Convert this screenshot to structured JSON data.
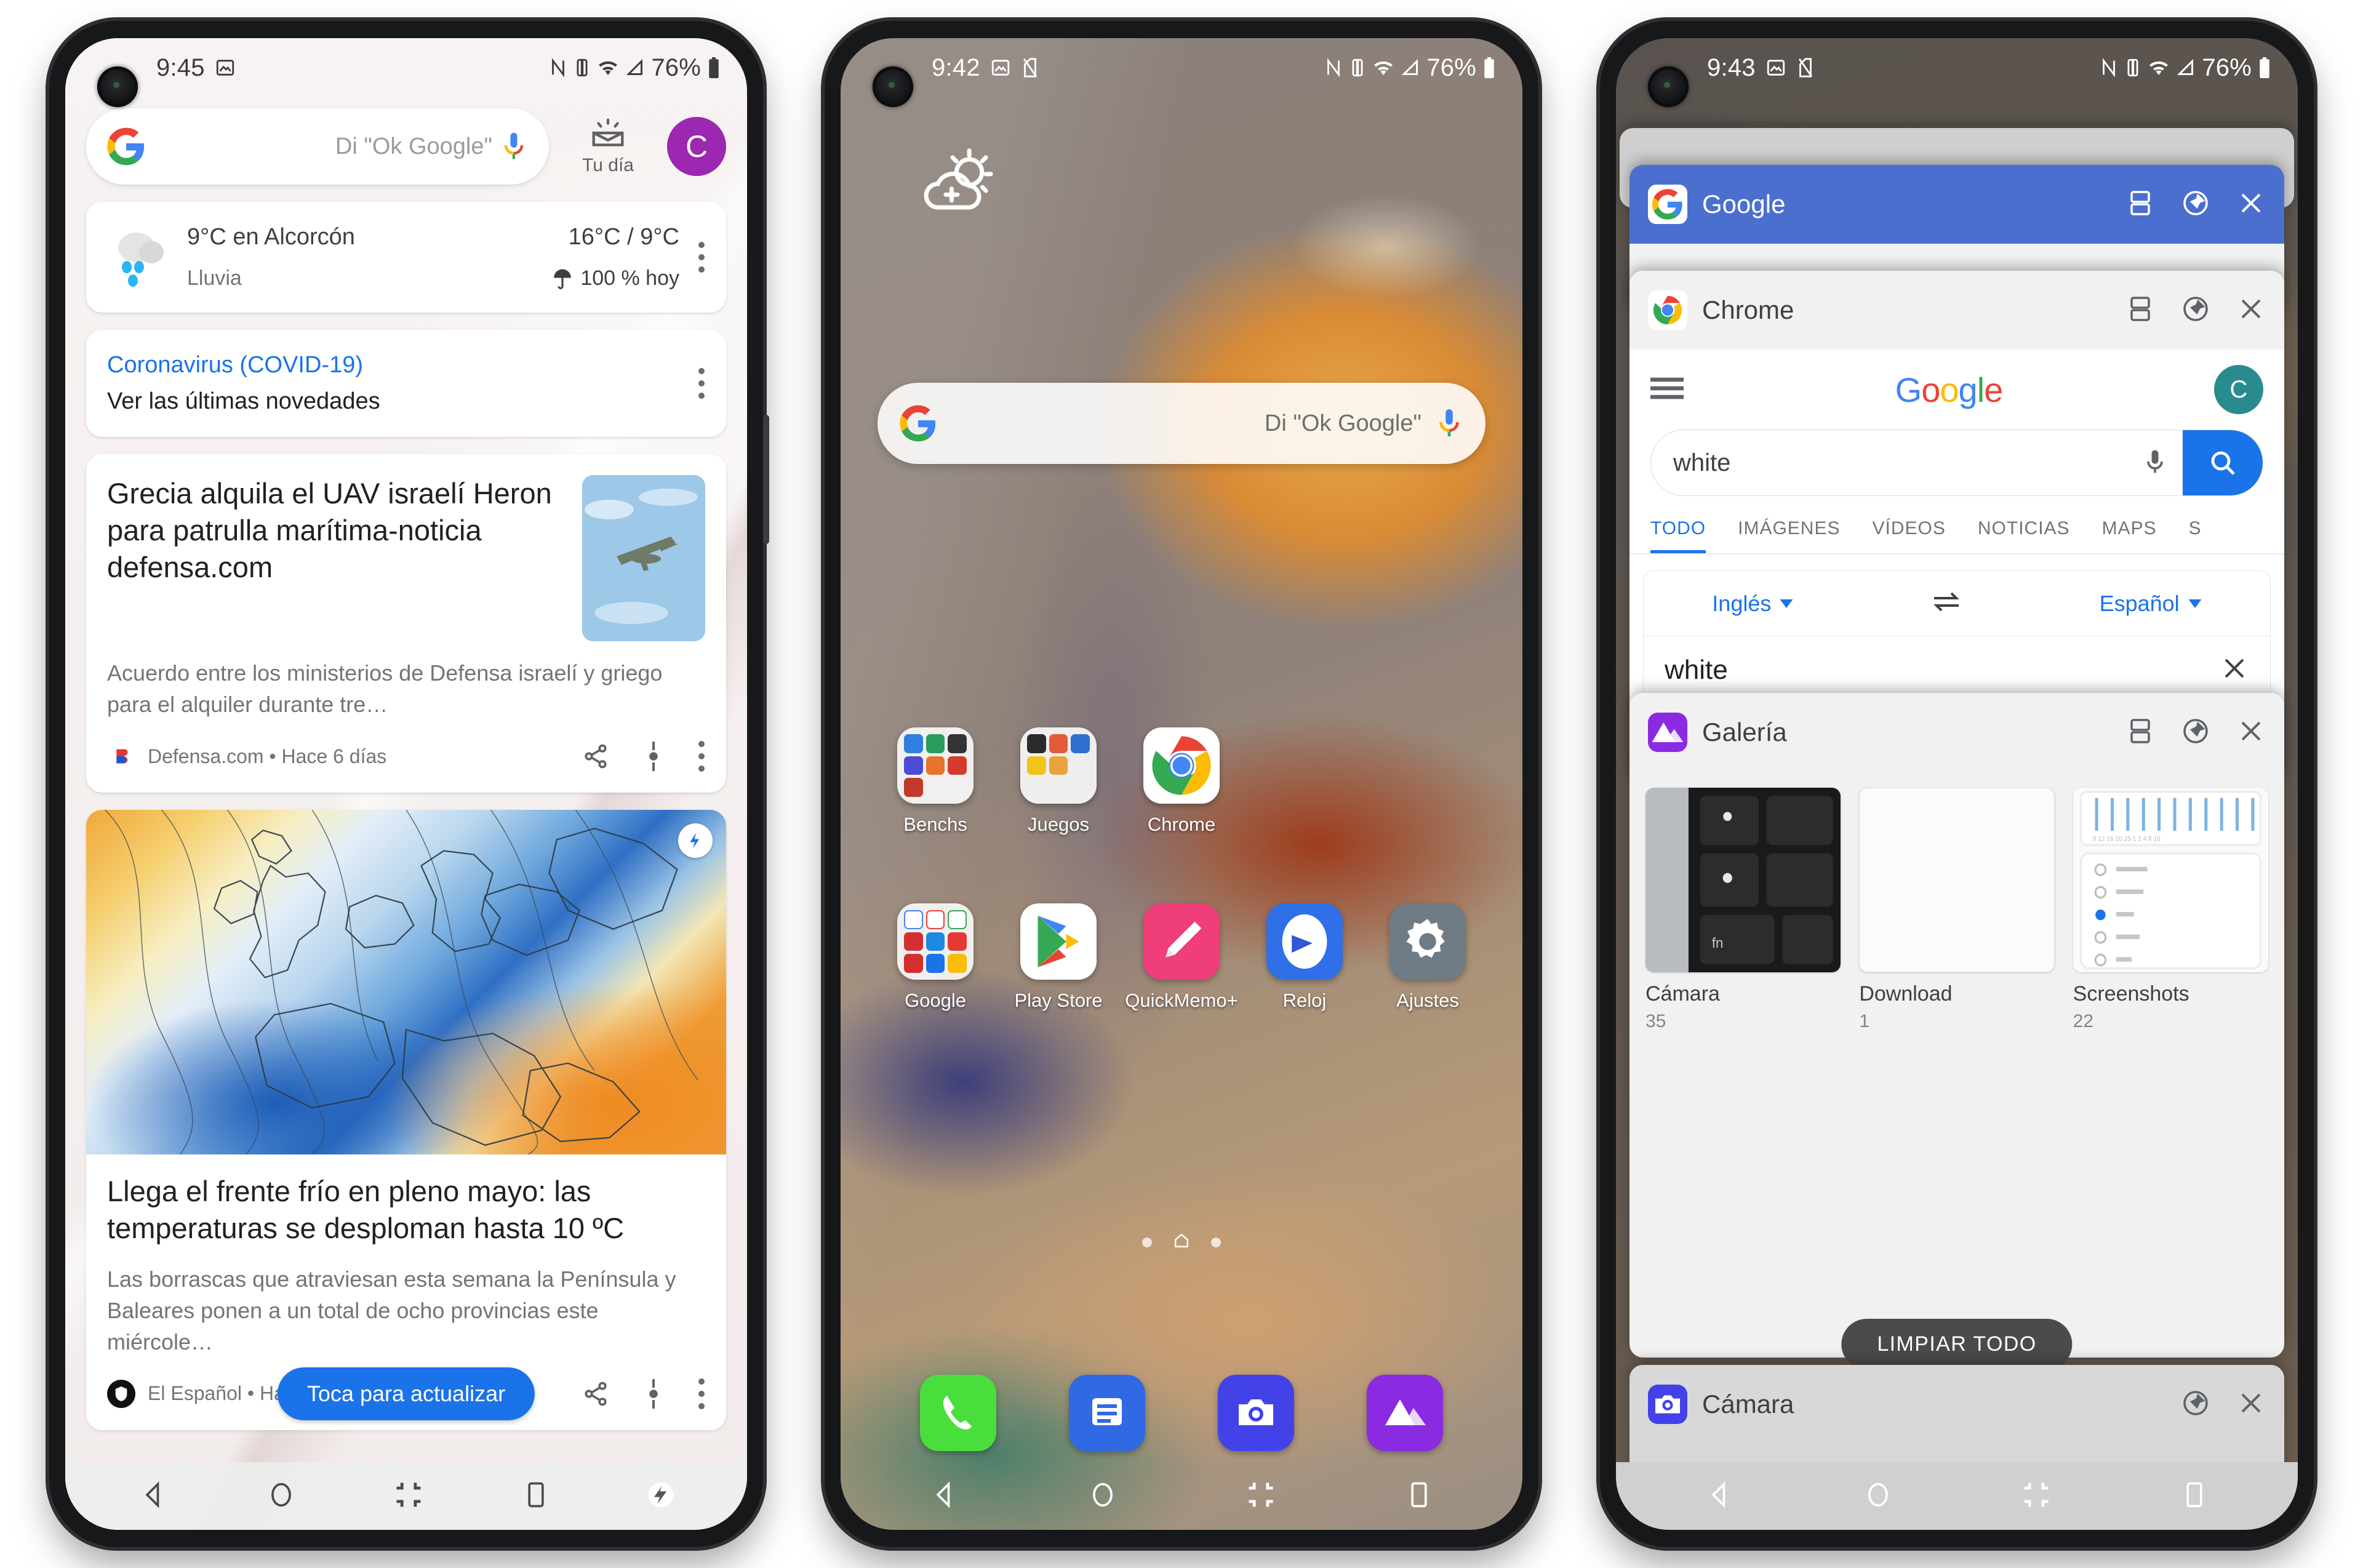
{
  "phones": [
    {
      "id": "phone-discover",
      "status_bar": {
        "time": "9:45",
        "battery_percent": "76%",
        "icons": [
          "screenshot-icon",
          "nfc-icon",
          "vibrate-icon",
          "wifi-icon",
          "signal-icon",
          "battery-icon"
        ]
      },
      "search": {
        "placeholder": "Di \"Ok Google\"",
        "mic_icon": "mic-icon",
        "google_logo": "google-g-icon",
        "your_day_label": "Tu día",
        "your_day_icon": "your-day-icon",
        "avatar_letter": "C",
        "avatar_color": "#9c27b0"
      },
      "weather_card": {
        "icon": "rain-cloud-icon",
        "temp_location": "9°C en Alcorcón",
        "condition": "Lluvia",
        "high_low": "16°C / 9°C",
        "rain_chance": "100 % hoy",
        "rain_icon": "umbrella-icon",
        "menu_icon": "kebab-menu-icon"
      },
      "covid_card": {
        "title": "Coronavirus (COVID-19)",
        "subtitle": "Ver las últimas novedades",
        "title_color": "#1a73e8",
        "menu_icon": "kebab-menu-icon"
      },
      "news_card": {
        "headline": "Grecia alquila el UAV israelí Heron para patrulla marítima-noticia defensa.com",
        "snippet": "Acuerdo entre los ministerios de Defensa israelí y griego para el alquiler durante tre…",
        "source": "Defensa.com • Hace 6 días",
        "thumb_alt": "drone-photo",
        "actions": [
          "share-icon",
          "more-vert-thin-icon",
          "kebab-menu-icon"
        ]
      },
      "feature_card": {
        "image_alt": "europe-temperature-map",
        "badge_icon": "lightning-bolt-icon",
        "headline": "Llega el frente frío en pleno mayo: las temperaturas se desploman hasta 10 ºC",
        "snippet": "Las borrascas que atraviesan esta semana la Península y Baleares ponen a un total de ocho provincias este miércole…",
        "source": "El Español • Hac",
        "refresh_button": "Toca para actualizar",
        "refresh_color": "#1a73e8"
      },
      "navbar": {
        "items": [
          "back-icon",
          "home-icon",
          "collapse-icon",
          "recents-icon",
          "quick-action-icon"
        ]
      }
    },
    {
      "id": "phone-home",
      "status_bar": {
        "time": "9:42",
        "battery_percent": "76%",
        "icons": [
          "screenshot-icon",
          "no-sim-icon",
          "nfc-icon",
          "vibrate-icon",
          "wifi-icon",
          "signal-icon",
          "battery-icon"
        ]
      },
      "weather_widget_icon": "cloud-sun-add-icon",
      "search": {
        "placeholder": "Di \"Ok Google\"",
        "google_logo": "google-g-icon",
        "mic_icon": "mic-icon"
      },
      "app_rows": [
        [
          {
            "label": "Benchs",
            "type": "folder"
          },
          {
            "label": "Juegos",
            "type": "folder"
          },
          {
            "label": "Chrome",
            "type": "app",
            "icon": "chrome-icon"
          }
        ],
        [
          {
            "label": "Google",
            "type": "folder"
          },
          {
            "label": "Play Store",
            "type": "app",
            "icon": "play-store-icon"
          },
          {
            "label": "QuickMemo+",
            "type": "app",
            "icon": "quickmemo-icon"
          },
          {
            "label": "Reloj",
            "type": "app",
            "icon": "clock-icon"
          },
          {
            "label": "Ajustes",
            "type": "app",
            "icon": "settings-gear-icon"
          }
        ]
      ],
      "page_dots": 3,
      "page_current": 1,
      "dock": [
        {
          "name": "phone-icon",
          "color": "#4ade3c"
        },
        {
          "name": "messages-icon",
          "color": "#3069e3"
        },
        {
          "name": "camera-icon",
          "color": "#4242e8"
        },
        {
          "name": "gallery-icon",
          "color": "#8a2be2"
        }
      ],
      "navbar": {
        "items": [
          "back-icon",
          "home-icon",
          "collapse-icon",
          "recents-icon"
        ]
      }
    },
    {
      "id": "phone-recents",
      "status_bar": {
        "time": "9:43",
        "battery_percent": "76%",
        "icons": [
          "screenshot-icon",
          "no-sim-icon",
          "nfc-icon",
          "vibrate-icon",
          "wifi-icon",
          "signal-icon",
          "battery-icon"
        ]
      },
      "cards": [
        {
          "title": "Google",
          "icon": "google-g-icon",
          "header_color": "#4a6fce",
          "controls": [
            "split-screen-icon",
            "pin-icon",
            "close-icon"
          ]
        },
        {
          "title": "Chrome",
          "icon": "chrome-icon",
          "header_color": "#f1f1f1",
          "controls": [
            "split-screen-icon",
            "pin-icon",
            "close-icon"
          ],
          "content": {
            "menu_icon": "hamburger-menu-icon",
            "logo": "Google",
            "avatar_letter": "C",
            "avatar_color": "#2a8b8f",
            "search_value": "white",
            "mic_icon": "mic-icon",
            "search_icon": "search-icon",
            "tabs": [
              "TODO",
              "IMÁGENES",
              "VÍDEOS",
              "NOTICIAS",
              "MAPS",
              "S"
            ],
            "active_tab": "TODO",
            "translate": {
              "source_lang": "Inglés",
              "swap_icon": "swap-icon",
              "target_lang": "Español",
              "input_value": "white",
              "clear_icon": "close-icon"
            }
          }
        },
        {
          "title": "Galería",
          "icon": "gallery-icon",
          "header_color": "#f1f1f1",
          "controls": [
            "split-screen-icon",
            "pin-icon",
            "close-icon"
          ],
          "albums": [
            {
              "name": "Cámara",
              "count": "35",
              "thumb": "keyboard-photo"
            },
            {
              "name": "Download",
              "count": "1",
              "thumb": "blank-photo"
            },
            {
              "name": "Screenshots",
              "count": "22",
              "thumb": "equalizer-screenshot"
            }
          ]
        },
        {
          "title": "Cámara",
          "icon": "camera-icon",
          "header_color": "#d8d8d8",
          "controls": [
            "pin-icon",
            "close-icon"
          ]
        }
      ],
      "clear_all_button": "LIMPIAR TODO",
      "navbar": {
        "items": [
          "back-icon",
          "home-icon",
          "collapse-icon",
          "recents-icon"
        ]
      }
    }
  ]
}
